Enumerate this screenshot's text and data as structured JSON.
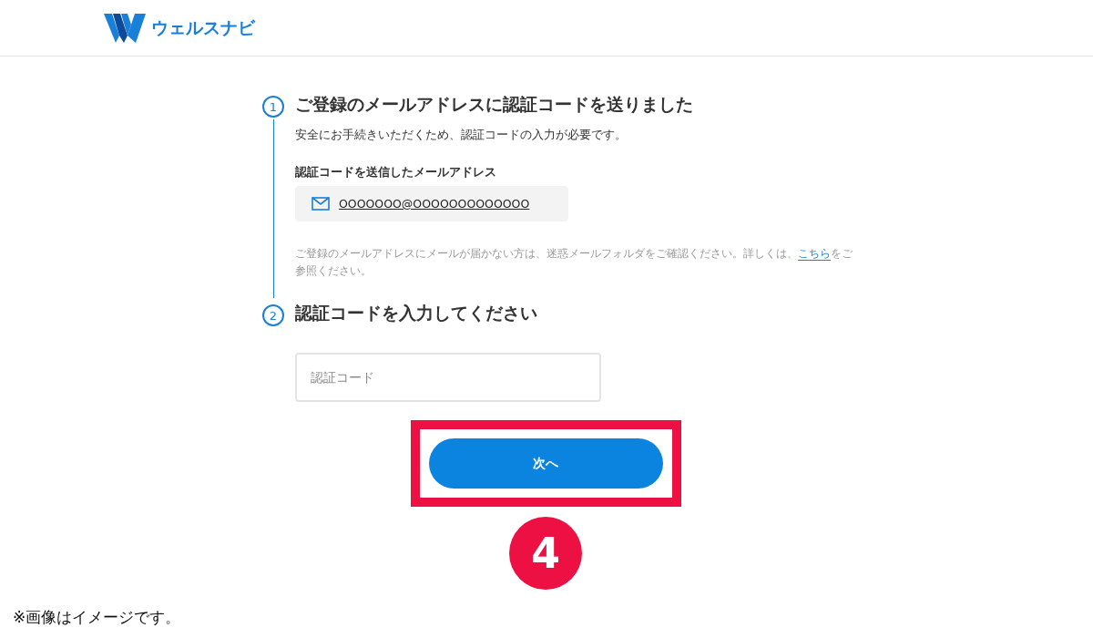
{
  "header": {
    "logo_text": "ウェルスナビ"
  },
  "steps": [
    {
      "number": "1",
      "title": "ご登録のメールアドレスに認証コードを送りました",
      "description": "安全にお手続きいただくため、認証コードの入力が必要です。",
      "email_label": "認証コードを送信したメールアドレス",
      "email": "OOOOOOO@OOOOOOOOOOOOO",
      "note_before": "ご登録のメールアドレスにメールが届かない方は、迷惑メールフォルダをご確認ください。詳しくは、",
      "note_link": "こちら",
      "note_after": "をご参照ください。"
    },
    {
      "number": "2",
      "title": "認証コードを入力してください",
      "placeholder": "認証コード"
    }
  ],
  "button": {
    "label": "次へ"
  },
  "annotation": {
    "number": "4"
  },
  "footnote": "※画像はイメージです。"
}
